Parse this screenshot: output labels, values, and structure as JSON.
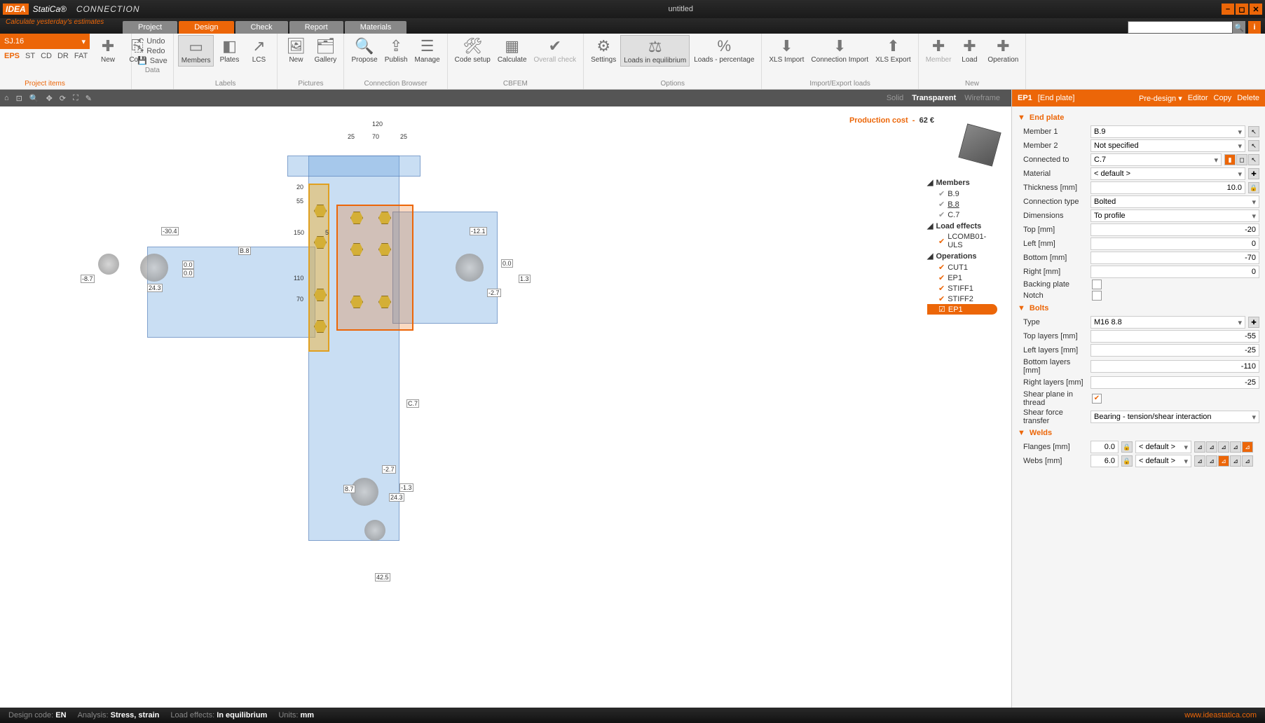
{
  "title": "untitled",
  "brand": {
    "idea": "IDEA",
    "statica": "StatiCa®",
    "conn": "CONNECTION",
    "tagline": "Calculate yesterday's estimates"
  },
  "tabs": [
    "Project",
    "Design",
    "Check",
    "Report",
    "Materials"
  ],
  "activeTab": "Design",
  "projectSelect": "SJ.16",
  "projectItemsLabel": "Project items",
  "projectTabs": [
    "EPS",
    "ST",
    "CD",
    "DR",
    "FAT"
  ],
  "projectTabsActive": "EPS",
  "ribbon": {
    "newcopy": {
      "new": "New",
      "copy": "Copy"
    },
    "data": {
      "undo": "Undo",
      "redo": "Redo",
      "save": "Save",
      "label": "Data"
    },
    "labels": {
      "members": "Members",
      "plates": "Plates",
      "lcs": "LCS",
      "label": "Labels"
    },
    "pictures": {
      "new": "New",
      "gallery": "Gallery",
      "label": "Pictures"
    },
    "browser": {
      "propose": "Propose",
      "publish": "Publish",
      "manage": "Manage",
      "label": "Connection Browser"
    },
    "cbfem": {
      "code": "Code\nsetup",
      "calc": "Calculate",
      "overall": "Overall\ncheck",
      "label": "CBFEM"
    },
    "options": {
      "settings": "Settings",
      "loadseq": "Loads in\nequilibrium",
      "loadspct": "Loads -\npercentage",
      "label": "Options"
    },
    "io": {
      "xlsimp": "XLS\nImport",
      "connimp": "Connection\nImport",
      "xlsexp": "XLS\nExport",
      "label": "Import/Export loads"
    },
    "new": {
      "member": "Member",
      "load": "Load",
      "operation": "Operation",
      "label": "New"
    }
  },
  "viewModes": [
    "Solid",
    "Transparent",
    "Wireframe"
  ],
  "viewModeActive": "Transparent",
  "productionCost": {
    "label": "Production cost",
    "value": "62 €"
  },
  "tree": {
    "members": {
      "header": "Members",
      "items": [
        "B.9",
        "B.8",
        "C.7"
      ]
    },
    "loads": {
      "header": "Load effects",
      "items": [
        "LCOMB01-ULS"
      ]
    },
    "ops": {
      "header": "Operations",
      "items": [
        "CUT1",
        "EP1",
        "STIFF1",
        "STIFF2",
        "EP1"
      ],
      "selected": 4
    }
  },
  "scene": {
    "dims": {
      "top_w": "120",
      "top_l": "25",
      "top_m": "70",
      "top_r": "25",
      "v1": "20",
      "v2": "55",
      "v3": "150",
      "v4": "5",
      "v5": "110",
      "v6": "70"
    },
    "labels": {
      "b8": "B.8",
      "c7": "C.7"
    },
    "forces": {
      "l1": "-30.4",
      "l2": "-8.7",
      "l3": "0.0",
      "l4": "0.0",
      "l5": "24.3",
      "r1": "-12.1",
      "r2": "0.0",
      "r3": "1.3",
      "r4": "-2.7",
      "b1": "-2.7",
      "b2": "8.7",
      "b3": "-1.3",
      "b4": "24.3",
      "b5": "42.5"
    }
  },
  "rightPanel": {
    "header": {
      "id": "EP1",
      "type": "[End plate]",
      "predesign": "Pre-design",
      "editor": "Editor",
      "copy": "Copy",
      "delete": "Delete"
    },
    "endplate": {
      "title": "End plate",
      "member1": {
        "label": "Member 1",
        "value": "B.9"
      },
      "member2": {
        "label": "Member 2",
        "value": "Not specified"
      },
      "connectedTo": {
        "label": "Connected to",
        "value": "C.7"
      },
      "material": {
        "label": "Material",
        "value": "< default >"
      },
      "thickness": {
        "label": "Thickness [mm]",
        "value": "10.0"
      },
      "conntype": {
        "label": "Connection type",
        "value": "Bolted"
      },
      "dimensions": {
        "label": "Dimensions",
        "value": "To profile"
      },
      "top": {
        "label": "Top [mm]",
        "value": "-20"
      },
      "left": {
        "label": "Left [mm]",
        "value": "0"
      },
      "bottom": {
        "label": "Bottom [mm]",
        "value": "-70"
      },
      "right": {
        "label": "Right [mm]",
        "value": "0"
      },
      "backing": {
        "label": "Backing plate"
      },
      "notch": {
        "label": "Notch"
      }
    },
    "bolts": {
      "title": "Bolts",
      "type": {
        "label": "Type",
        "value": "M16 8.8"
      },
      "topLayers": {
        "label": "Top layers [mm]",
        "value": "-55"
      },
      "leftLayers": {
        "label": "Left layers [mm]",
        "value": "-25"
      },
      "bottomLayers": {
        "label": "Bottom layers [mm]",
        "value": "-110"
      },
      "rightLayers": {
        "label": "Right layers [mm]",
        "value": "-25"
      },
      "shearPlane": {
        "label": "Shear plane in thread"
      },
      "shearForce": {
        "label": "Shear force transfer",
        "value": "Bearing - tension/shear interaction"
      }
    },
    "welds": {
      "title": "Welds",
      "flanges": {
        "label": "Flanges [mm]",
        "value": "0.0",
        "mat": "< default >"
      },
      "webs": {
        "label": "Webs [mm]",
        "value": "6.0",
        "mat": "< default >"
      }
    }
  },
  "status": {
    "code": {
      "label": "Design code:",
      "value": "EN"
    },
    "analysis": {
      "label": "Analysis:",
      "value": "Stress, strain"
    },
    "loads": {
      "label": "Load effects:",
      "value": "In equilibrium"
    },
    "units": {
      "label": "Units:",
      "value": "mm"
    },
    "link": "www.ideastatica.com"
  }
}
